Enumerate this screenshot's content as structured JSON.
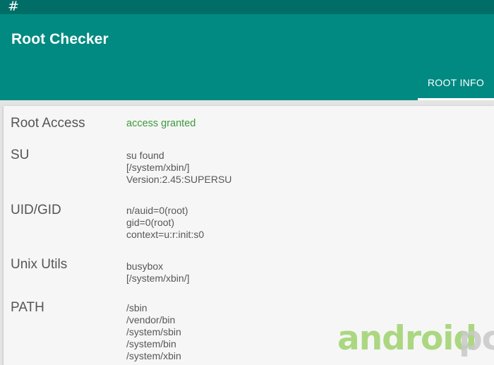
{
  "status_bar": {
    "icon": "#"
  },
  "app_bar": {
    "title": "Root Checker",
    "tabs": [
      {
        "label": "ROOT INFO",
        "active": true
      }
    ]
  },
  "info": {
    "root_access": {
      "label": "Root Access",
      "value": "access granted"
    },
    "su": {
      "label": "SU",
      "lines": [
        "su found",
        "[/system/xbin/]",
        "Version:2.45:SUPERSU"
      ]
    },
    "uid_gid": {
      "label": "UID/GID",
      "lines": [
        "n/auid=0(root)",
        "gid=0(root)",
        "context=u:r:init:s0"
      ]
    },
    "unix_utils": {
      "label": "Unix Utils",
      "lines": [
        "busybox",
        "[/system/xbin/]"
      ]
    },
    "path": {
      "label": "PATH",
      "lines": [
        "/sbin",
        "/vendor/bin",
        "/system/sbin",
        "/system/bin",
        "/system/xbin"
      ]
    }
  },
  "watermark": {
    "part1": "android",
    "part2": "pc"
  },
  "colors": {
    "status_bar": "#006e66",
    "app_bar": "#008a82",
    "granted": "#3c9a3c",
    "card": "#f6f6f6",
    "watermark_green": "#9fd26d",
    "watermark_gray": "#c9c9c9"
  }
}
